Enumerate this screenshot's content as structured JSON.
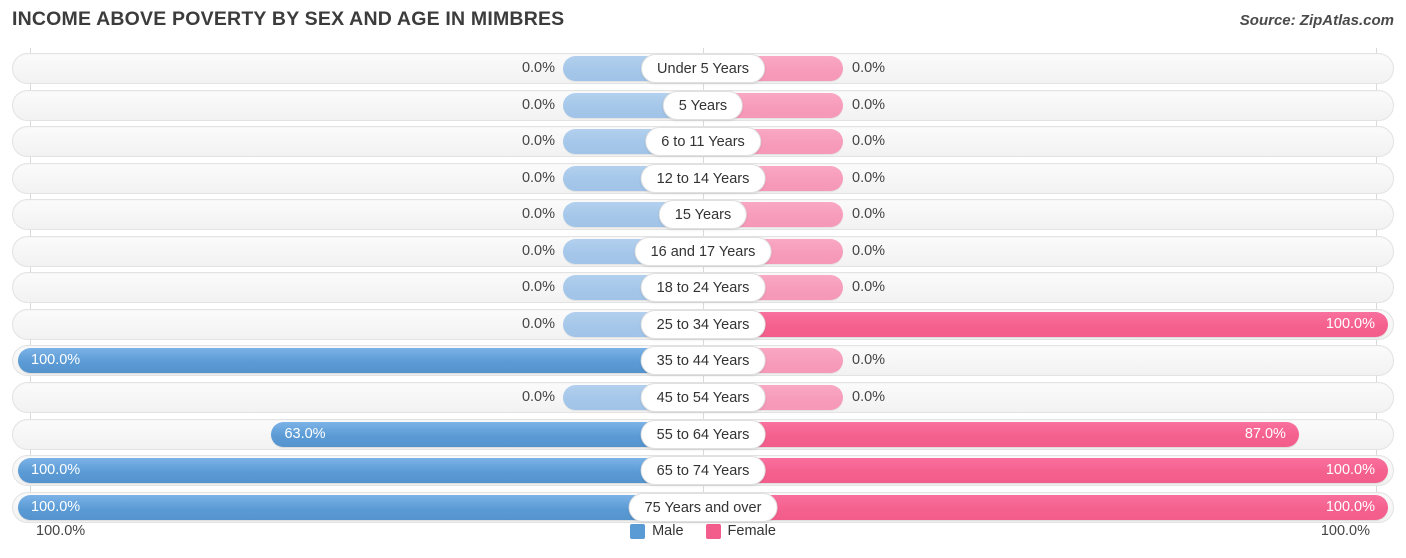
{
  "header": {
    "title": "INCOME ABOVE POVERTY BY SEX AND AGE IN MIMBRES",
    "source": "Source: ZipAtlas.com"
  },
  "legend": {
    "male_label": "Male",
    "female_label": "Female",
    "male_color": "#5b9bd5",
    "female_color": "#f25d8b"
  },
  "axis": {
    "left_max_label": "100.0%",
    "right_max_label": "100.0%"
  },
  "chart_data": {
    "type": "bar",
    "orientation": "horizontal-diverging",
    "title": "INCOME ABOVE POVERTY BY SEX AND AGE IN MIMBRES",
    "xlabel": "",
    "ylabel": "",
    "xlim": [
      0,
      100
    ],
    "grid": true,
    "legend_position": "bottom-center",
    "categories": [
      "Under 5 Years",
      "5 Years",
      "6 to 11 Years",
      "12 to 14 Years",
      "15 Years",
      "16 and 17 Years",
      "18 to 24 Years",
      "25 to 34 Years",
      "35 to 44 Years",
      "45 to 54 Years",
      "55 to 64 Years",
      "65 to 74 Years",
      "75 Years and over"
    ],
    "series": [
      {
        "name": "Male",
        "values": [
          0.0,
          0.0,
          0.0,
          0.0,
          0.0,
          0.0,
          0.0,
          0.0,
          100.0,
          0.0,
          63.0,
          100.0,
          100.0
        ],
        "labels": [
          "0.0%",
          "0.0%",
          "0.0%",
          "0.0%",
          "0.0%",
          "0.0%",
          "0.0%",
          "0.0%",
          "100.0%",
          "0.0%",
          "63.0%",
          "100.0%",
          "100.0%"
        ]
      },
      {
        "name": "Female",
        "values": [
          0.0,
          0.0,
          0.0,
          0.0,
          0.0,
          0.0,
          0.0,
          100.0,
          0.0,
          0.0,
          87.0,
          100.0,
          100.0
        ],
        "labels": [
          "0.0%",
          "0.0%",
          "0.0%",
          "0.0%",
          "0.0%",
          "0.0%",
          "0.0%",
          "100.0%",
          "0.0%",
          "0.0%",
          "87.0%",
          "100.0%",
          "100.0%"
        ]
      }
    ]
  }
}
